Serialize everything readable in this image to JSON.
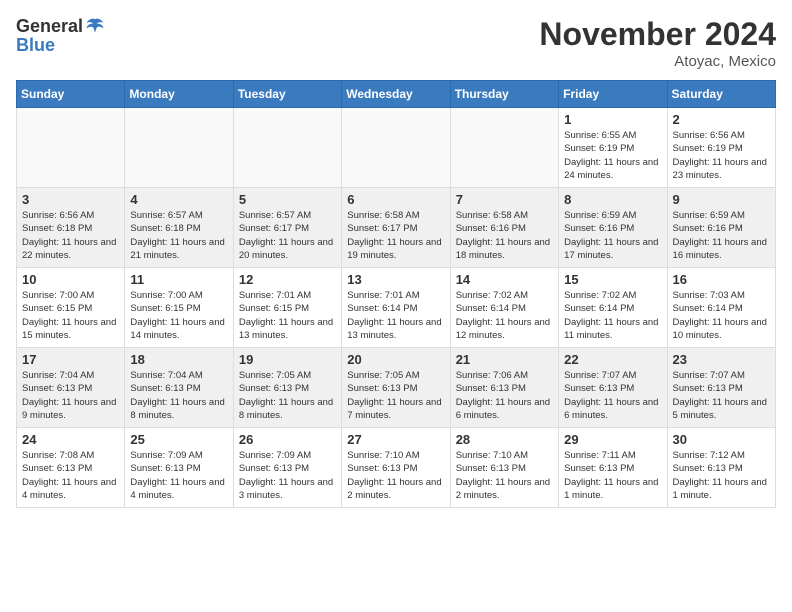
{
  "header": {
    "logo_general": "General",
    "logo_blue": "Blue",
    "month": "November 2024",
    "location": "Atoyac, Mexico"
  },
  "days_of_week": [
    "Sunday",
    "Monday",
    "Tuesday",
    "Wednesday",
    "Thursday",
    "Friday",
    "Saturday"
  ],
  "weeks": [
    {
      "days": [
        {
          "date": "",
          "empty": true
        },
        {
          "date": "",
          "empty": true
        },
        {
          "date": "",
          "empty": true
        },
        {
          "date": "",
          "empty": true
        },
        {
          "date": "",
          "empty": true
        },
        {
          "date": "1",
          "sunrise": "6:55 AM",
          "sunset": "6:19 PM",
          "daylight": "11 hours and 24 minutes."
        },
        {
          "date": "2",
          "sunrise": "6:56 AM",
          "sunset": "6:19 PM",
          "daylight": "11 hours and 23 minutes."
        }
      ]
    },
    {
      "days": [
        {
          "date": "3",
          "sunrise": "6:56 AM",
          "sunset": "6:18 PM",
          "daylight": "11 hours and 22 minutes."
        },
        {
          "date": "4",
          "sunrise": "6:57 AM",
          "sunset": "6:18 PM",
          "daylight": "11 hours and 21 minutes."
        },
        {
          "date": "5",
          "sunrise": "6:57 AM",
          "sunset": "6:17 PM",
          "daylight": "11 hours and 20 minutes."
        },
        {
          "date": "6",
          "sunrise": "6:58 AM",
          "sunset": "6:17 PM",
          "daylight": "11 hours and 19 minutes."
        },
        {
          "date": "7",
          "sunrise": "6:58 AM",
          "sunset": "6:16 PM",
          "daylight": "11 hours and 18 minutes."
        },
        {
          "date": "8",
          "sunrise": "6:59 AM",
          "sunset": "6:16 PM",
          "daylight": "11 hours and 17 minutes."
        },
        {
          "date": "9",
          "sunrise": "6:59 AM",
          "sunset": "6:16 PM",
          "daylight": "11 hours and 16 minutes."
        }
      ]
    },
    {
      "days": [
        {
          "date": "10",
          "sunrise": "7:00 AM",
          "sunset": "6:15 PM",
          "daylight": "11 hours and 15 minutes."
        },
        {
          "date": "11",
          "sunrise": "7:00 AM",
          "sunset": "6:15 PM",
          "daylight": "11 hours and 14 minutes."
        },
        {
          "date": "12",
          "sunrise": "7:01 AM",
          "sunset": "6:15 PM",
          "daylight": "11 hours and 13 minutes."
        },
        {
          "date": "13",
          "sunrise": "7:01 AM",
          "sunset": "6:14 PM",
          "daylight": "11 hours and 13 minutes."
        },
        {
          "date": "14",
          "sunrise": "7:02 AM",
          "sunset": "6:14 PM",
          "daylight": "11 hours and 12 minutes."
        },
        {
          "date": "15",
          "sunrise": "7:02 AM",
          "sunset": "6:14 PM",
          "daylight": "11 hours and 11 minutes."
        },
        {
          "date": "16",
          "sunrise": "7:03 AM",
          "sunset": "6:14 PM",
          "daylight": "11 hours and 10 minutes."
        }
      ]
    },
    {
      "days": [
        {
          "date": "17",
          "sunrise": "7:04 AM",
          "sunset": "6:13 PM",
          "daylight": "11 hours and 9 minutes."
        },
        {
          "date": "18",
          "sunrise": "7:04 AM",
          "sunset": "6:13 PM",
          "daylight": "11 hours and 8 minutes."
        },
        {
          "date": "19",
          "sunrise": "7:05 AM",
          "sunset": "6:13 PM",
          "daylight": "11 hours and 8 minutes."
        },
        {
          "date": "20",
          "sunrise": "7:05 AM",
          "sunset": "6:13 PM",
          "daylight": "11 hours and 7 minutes."
        },
        {
          "date": "21",
          "sunrise": "7:06 AM",
          "sunset": "6:13 PM",
          "daylight": "11 hours and 6 minutes."
        },
        {
          "date": "22",
          "sunrise": "7:07 AM",
          "sunset": "6:13 PM",
          "daylight": "11 hours and 6 minutes."
        },
        {
          "date": "23",
          "sunrise": "7:07 AM",
          "sunset": "6:13 PM",
          "daylight": "11 hours and 5 minutes."
        }
      ]
    },
    {
      "days": [
        {
          "date": "24",
          "sunrise": "7:08 AM",
          "sunset": "6:13 PM",
          "daylight": "11 hours and 4 minutes."
        },
        {
          "date": "25",
          "sunrise": "7:09 AM",
          "sunset": "6:13 PM",
          "daylight": "11 hours and 4 minutes."
        },
        {
          "date": "26",
          "sunrise": "7:09 AM",
          "sunset": "6:13 PM",
          "daylight": "11 hours and 3 minutes."
        },
        {
          "date": "27",
          "sunrise": "7:10 AM",
          "sunset": "6:13 PM",
          "daylight": "11 hours and 2 minutes."
        },
        {
          "date": "28",
          "sunrise": "7:10 AM",
          "sunset": "6:13 PM",
          "daylight": "11 hours and 2 minutes."
        },
        {
          "date": "29",
          "sunrise": "7:11 AM",
          "sunset": "6:13 PM",
          "daylight": "11 hours and 1 minute."
        },
        {
          "date": "30",
          "sunrise": "7:12 AM",
          "sunset": "6:13 PM",
          "daylight": "11 hours and 1 minute."
        }
      ]
    }
  ]
}
